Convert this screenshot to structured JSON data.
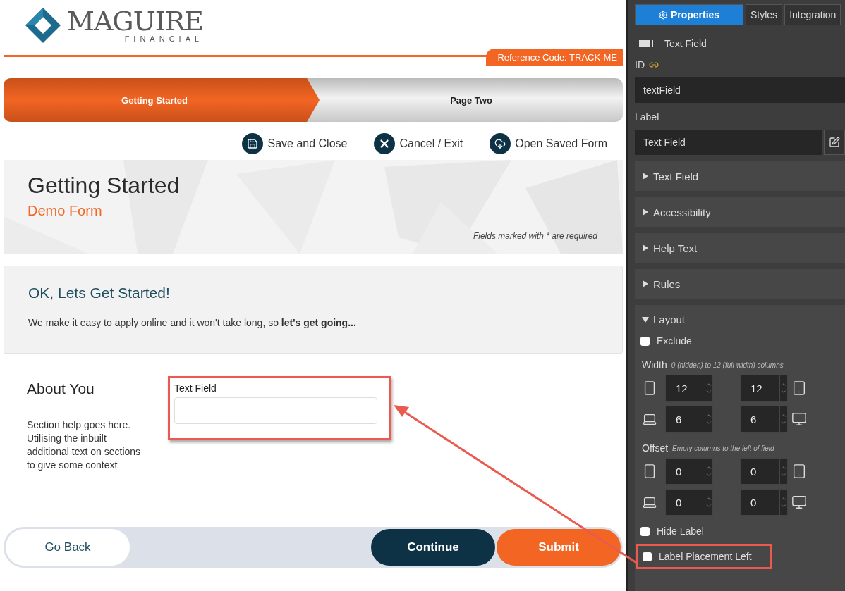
{
  "logo": {
    "name": "MAGUIRE",
    "subtitle": "FINANCIAL"
  },
  "reference_code": "Reference Code: TRACK-ME",
  "steps": [
    {
      "label": "Getting Started",
      "selected": true
    },
    {
      "label": "Page Two",
      "selected": false
    }
  ],
  "actions": [
    {
      "kind": "save",
      "label": "Save and Close"
    },
    {
      "kind": "cancel",
      "label": "Cancel / Exit"
    },
    {
      "kind": "open",
      "label": "Open Saved Form"
    }
  ],
  "banner": {
    "title": "Getting Started",
    "subtitle": "Demo Form",
    "note": "Fields marked with * are required"
  },
  "intro": {
    "heading": "OK, Lets Get Started!",
    "text": "We make it easy to apply online and it won't take long, so **let's get going...**"
  },
  "section": {
    "title": "About You",
    "help": "Section help goes here. Utilising the inbuilt additional text on sections to give some context",
    "field_label": "Text Field",
    "highlighted": true
  },
  "nav_buttons": [
    {
      "kind": "back",
      "label": "Go Back"
    },
    {
      "kind": "continue",
      "label": "Continue"
    },
    {
      "kind": "submit",
      "label": "Submit"
    }
  ],
  "panel": {
    "tabs": [
      {
        "label": "Properties",
        "selected": true
      },
      {
        "label": "Styles",
        "selected": false
      },
      {
        "label": "Integration",
        "selected": false
      }
    ],
    "component": "Text Field",
    "id_label": "ID",
    "id_value": "textField",
    "label_label": "Label",
    "label_value": "Text Field",
    "groups": [
      {
        "label": "Text Field",
        "expanded": false
      },
      {
        "label": "Accessibility",
        "expanded": false
      },
      {
        "label": "Help Text",
        "expanded": false
      },
      {
        "label": "Rules",
        "expanded": false
      },
      {
        "label": "Layout",
        "expanded": true
      }
    ],
    "exclude": {
      "label": "Exclude",
      "checked": false,
      "highlighted": false
    },
    "grids": [
      {
        "label": "Width",
        "hint": "0 (hidden) to 12 (full-width) columns",
        "values": [
          "12",
          "12",
          "6",
          "6"
        ]
      },
      {
        "label": "Offset",
        "hint": "Empty columns to the left of field",
        "values": [
          "0",
          "0",
          "0",
          "0"
        ]
      }
    ],
    "options": [
      {
        "label": "Hide Label",
        "checked": false,
        "highlighted": false
      },
      {
        "label": "Label Placement Left",
        "checked": false,
        "highlighted": true
      }
    ]
  }
}
